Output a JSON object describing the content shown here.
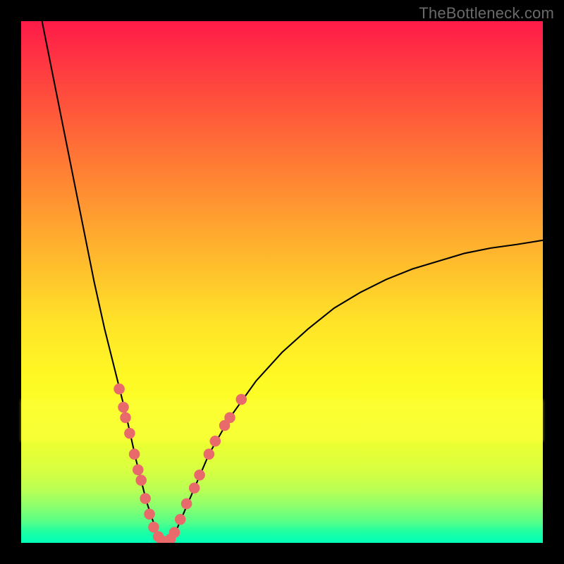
{
  "watermark": "TheBottleneck.com",
  "chart_data": {
    "type": "line",
    "title": "",
    "xlabel": "",
    "ylabel": "",
    "xlim": [
      0,
      100
    ],
    "ylim": [
      0,
      100
    ],
    "description": "V-shaped bottleneck curve on rainbow gradient background; minimum near x≈27, y≈0. Curve steep on left branch, rises to ~100 at x=0; shallower on right branch, rises to ~58 at x=100.",
    "curve_left": [
      {
        "x": 4.0,
        "y": 100.0
      },
      {
        "x": 6.0,
        "y": 90.0
      },
      {
        "x": 8.0,
        "y": 80.0
      },
      {
        "x": 10.0,
        "y": 70.0
      },
      {
        "x": 12.0,
        "y": 60.0
      },
      {
        "x": 14.0,
        "y": 50.0
      },
      {
        "x": 16.0,
        "y": 41.0
      },
      {
        "x": 18.0,
        "y": 33.0
      },
      {
        "x": 20.0,
        "y": 25.0
      },
      {
        "x": 22.0,
        "y": 16.0
      },
      {
        "x": 24.0,
        "y": 8.0
      },
      {
        "x": 26.0,
        "y": 2.0
      },
      {
        "x": 27.5,
        "y": 0.0
      }
    ],
    "curve_right": [
      {
        "x": 27.5,
        "y": 0.0
      },
      {
        "x": 30.0,
        "y": 3.0
      },
      {
        "x": 33.0,
        "y": 10.0
      },
      {
        "x": 36.0,
        "y": 17.0
      },
      {
        "x": 40.0,
        "y": 24.0
      },
      {
        "x": 45.0,
        "y": 31.0
      },
      {
        "x": 50.0,
        "y": 36.5
      },
      {
        "x": 55.0,
        "y": 41.0
      },
      {
        "x": 60.0,
        "y": 45.0
      },
      {
        "x": 65.0,
        "y": 48.0
      },
      {
        "x": 70.0,
        "y": 50.5
      },
      {
        "x": 75.0,
        "y": 52.5
      },
      {
        "x": 80.0,
        "y": 54.0
      },
      {
        "x": 85.0,
        "y": 55.5
      },
      {
        "x": 90.0,
        "y": 56.5
      },
      {
        "x": 95.0,
        "y": 57.2
      },
      {
        "x": 100.0,
        "y": 58.0
      }
    ],
    "highlight_points": [
      {
        "x": 18.8,
        "y": 29.5
      },
      {
        "x": 19.6,
        "y": 26.0
      },
      {
        "x": 20.0,
        "y": 24.0
      },
      {
        "x": 20.8,
        "y": 21.0
      },
      {
        "x": 21.7,
        "y": 17.0
      },
      {
        "x": 22.4,
        "y": 14.0
      },
      {
        "x": 23.0,
        "y": 12.0
      },
      {
        "x": 23.8,
        "y": 8.5
      },
      {
        "x": 24.6,
        "y": 5.5
      },
      {
        "x": 25.4,
        "y": 3.0
      },
      {
        "x": 26.3,
        "y": 1.2
      },
      {
        "x": 27.0,
        "y": 0.4
      },
      {
        "x": 27.8,
        "y": 0.2
      },
      {
        "x": 28.6,
        "y": 0.7
      },
      {
        "x": 29.4,
        "y": 2.0
      },
      {
        "x": 30.5,
        "y": 4.5
      },
      {
        "x": 31.7,
        "y": 7.5
      },
      {
        "x": 33.2,
        "y": 10.5
      },
      {
        "x": 34.2,
        "y": 13.0
      },
      {
        "x": 36.0,
        "y": 17.0
      },
      {
        "x": 37.2,
        "y": 19.5
      },
      {
        "x": 39.0,
        "y": 22.5
      },
      {
        "x": 40.0,
        "y": 24.0
      },
      {
        "x": 42.2,
        "y": 27.5
      }
    ],
    "gradient_stops": [
      {
        "pos": 0.0,
        "color": "#ff1a49"
      },
      {
        "pos": 0.18,
        "color": "#ff5a3a"
      },
      {
        "pos": 0.38,
        "color": "#ffa030"
      },
      {
        "pos": 0.58,
        "color": "#ffe428"
      },
      {
        "pos": 0.74,
        "color": "#fbff28"
      },
      {
        "pos": 0.9,
        "color": "#b8ff55"
      },
      {
        "pos": 1.0,
        "color": "#00ffb8"
      }
    ]
  }
}
